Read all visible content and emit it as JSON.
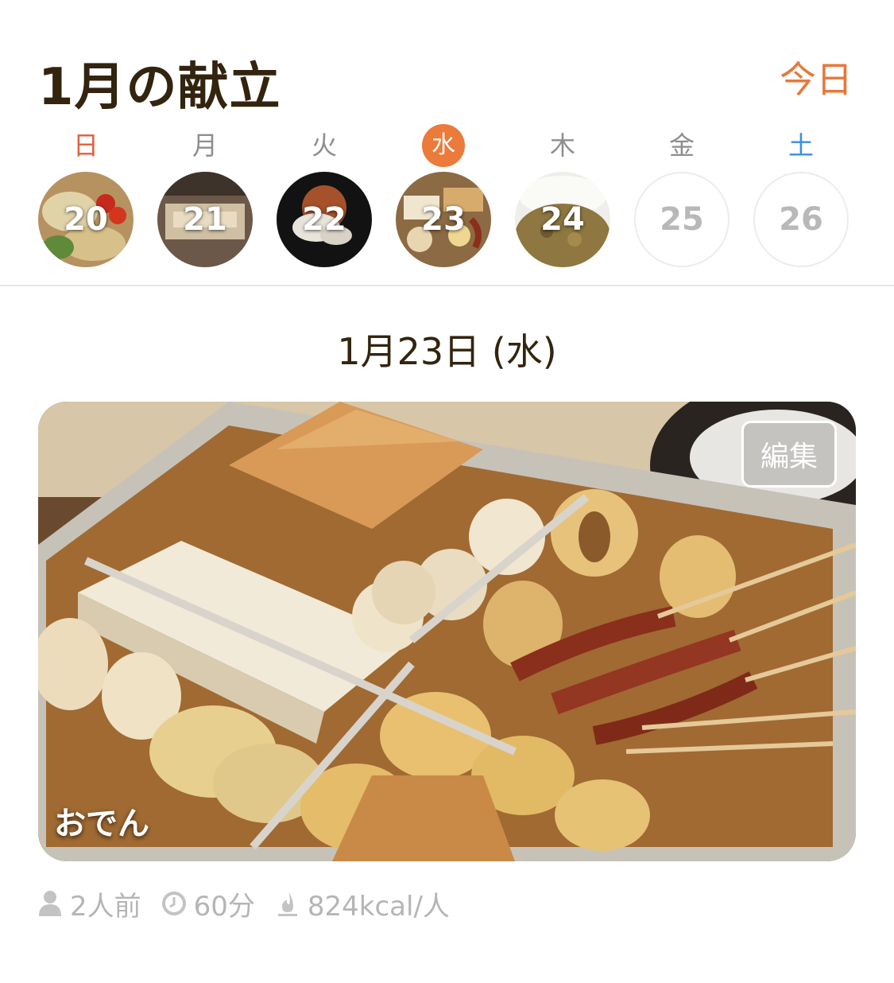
{
  "header": {
    "title": "1月の献立",
    "today_label": "今日"
  },
  "week": [
    {
      "dow": "日",
      "date": "20",
      "has_photo": true
    },
    {
      "dow": "月",
      "date": "21",
      "has_photo": true
    },
    {
      "dow": "火",
      "date": "22",
      "has_photo": true
    },
    {
      "dow": "水",
      "date": "23",
      "has_photo": true,
      "selected": true
    },
    {
      "dow": "木",
      "date": "24",
      "has_photo": true
    },
    {
      "dow": "金",
      "date": "25",
      "has_photo": false
    },
    {
      "dow": "土",
      "date": "26",
      "has_photo": false
    }
  ],
  "selected_date_label": "1月23日 (水)",
  "recipe": {
    "name": "おでん",
    "edit_label": "編集",
    "servings": "2人前",
    "time": "60分",
    "calories": "824kcal/人"
  },
  "colors": {
    "accent": "#ec7a3a",
    "sunday": "#e0603e",
    "saturday": "#3a8ee6",
    "meta_text": "#b5b5b5"
  }
}
